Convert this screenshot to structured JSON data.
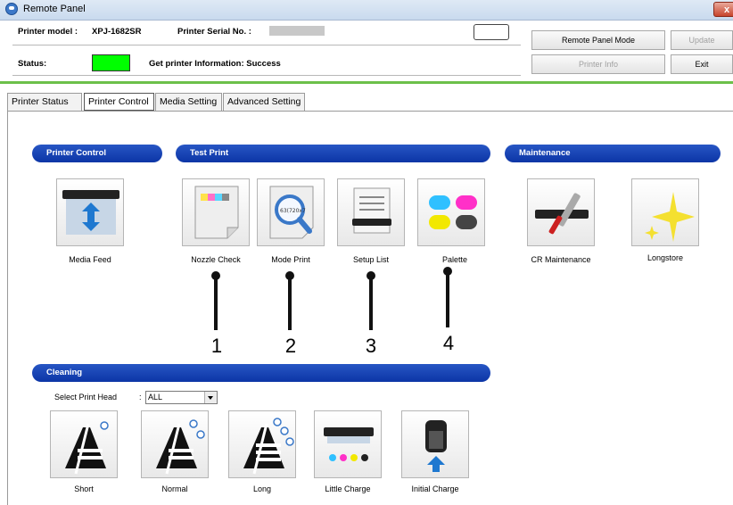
{
  "window": {
    "title": "Remote Panel",
    "close_glyph": "x"
  },
  "header": {
    "printer_model_label": "Printer model :",
    "printer_model_value": "XPJ-1682SR",
    "serial_label": "Printer Serial No. :",
    "serial_value": "",
    "status_label": "Status:",
    "status_message": "Get printer Information: Success",
    "status_color": "#00ff00"
  },
  "buttons": {
    "remote_panel_mode": "Remote Panel Mode",
    "update": "Update",
    "printer_info": "Printer Info",
    "exit": "Exit"
  },
  "tabs": [
    {
      "label": "Printer Status"
    },
    {
      "label": "Printer Control"
    },
    {
      "label": "Media Setting"
    },
    {
      "label": "Advanced Setting"
    }
  ],
  "sections": {
    "printer_control": "Printer Control",
    "test_print": "Test Print",
    "maintenance": "Maintenance",
    "cleaning": "Cleaning"
  },
  "tiles": {
    "media_feed": "Media Feed",
    "nozzle_check": "Nozzle Check",
    "mode_print": "Mode Print",
    "setup_list": "Setup List",
    "palette": "Palette",
    "cr_maintenance": "CR Maintenance",
    "longstore": "Longstore",
    "short": "Short",
    "normal": "Normal",
    "long": "Long",
    "little_charge": "Little Charge",
    "initial_charge": "Initial Charge"
  },
  "mode_print_icon_text": "63(720x7",
  "callouts": [
    "1",
    "2",
    "3",
    "4"
  ],
  "cleaning": {
    "select_label": "Select Print Head",
    "select_colon": ":",
    "select_value": "ALL"
  },
  "colors": {
    "section_blue": "#1446b8",
    "accent_green": "#6cc04a"
  }
}
